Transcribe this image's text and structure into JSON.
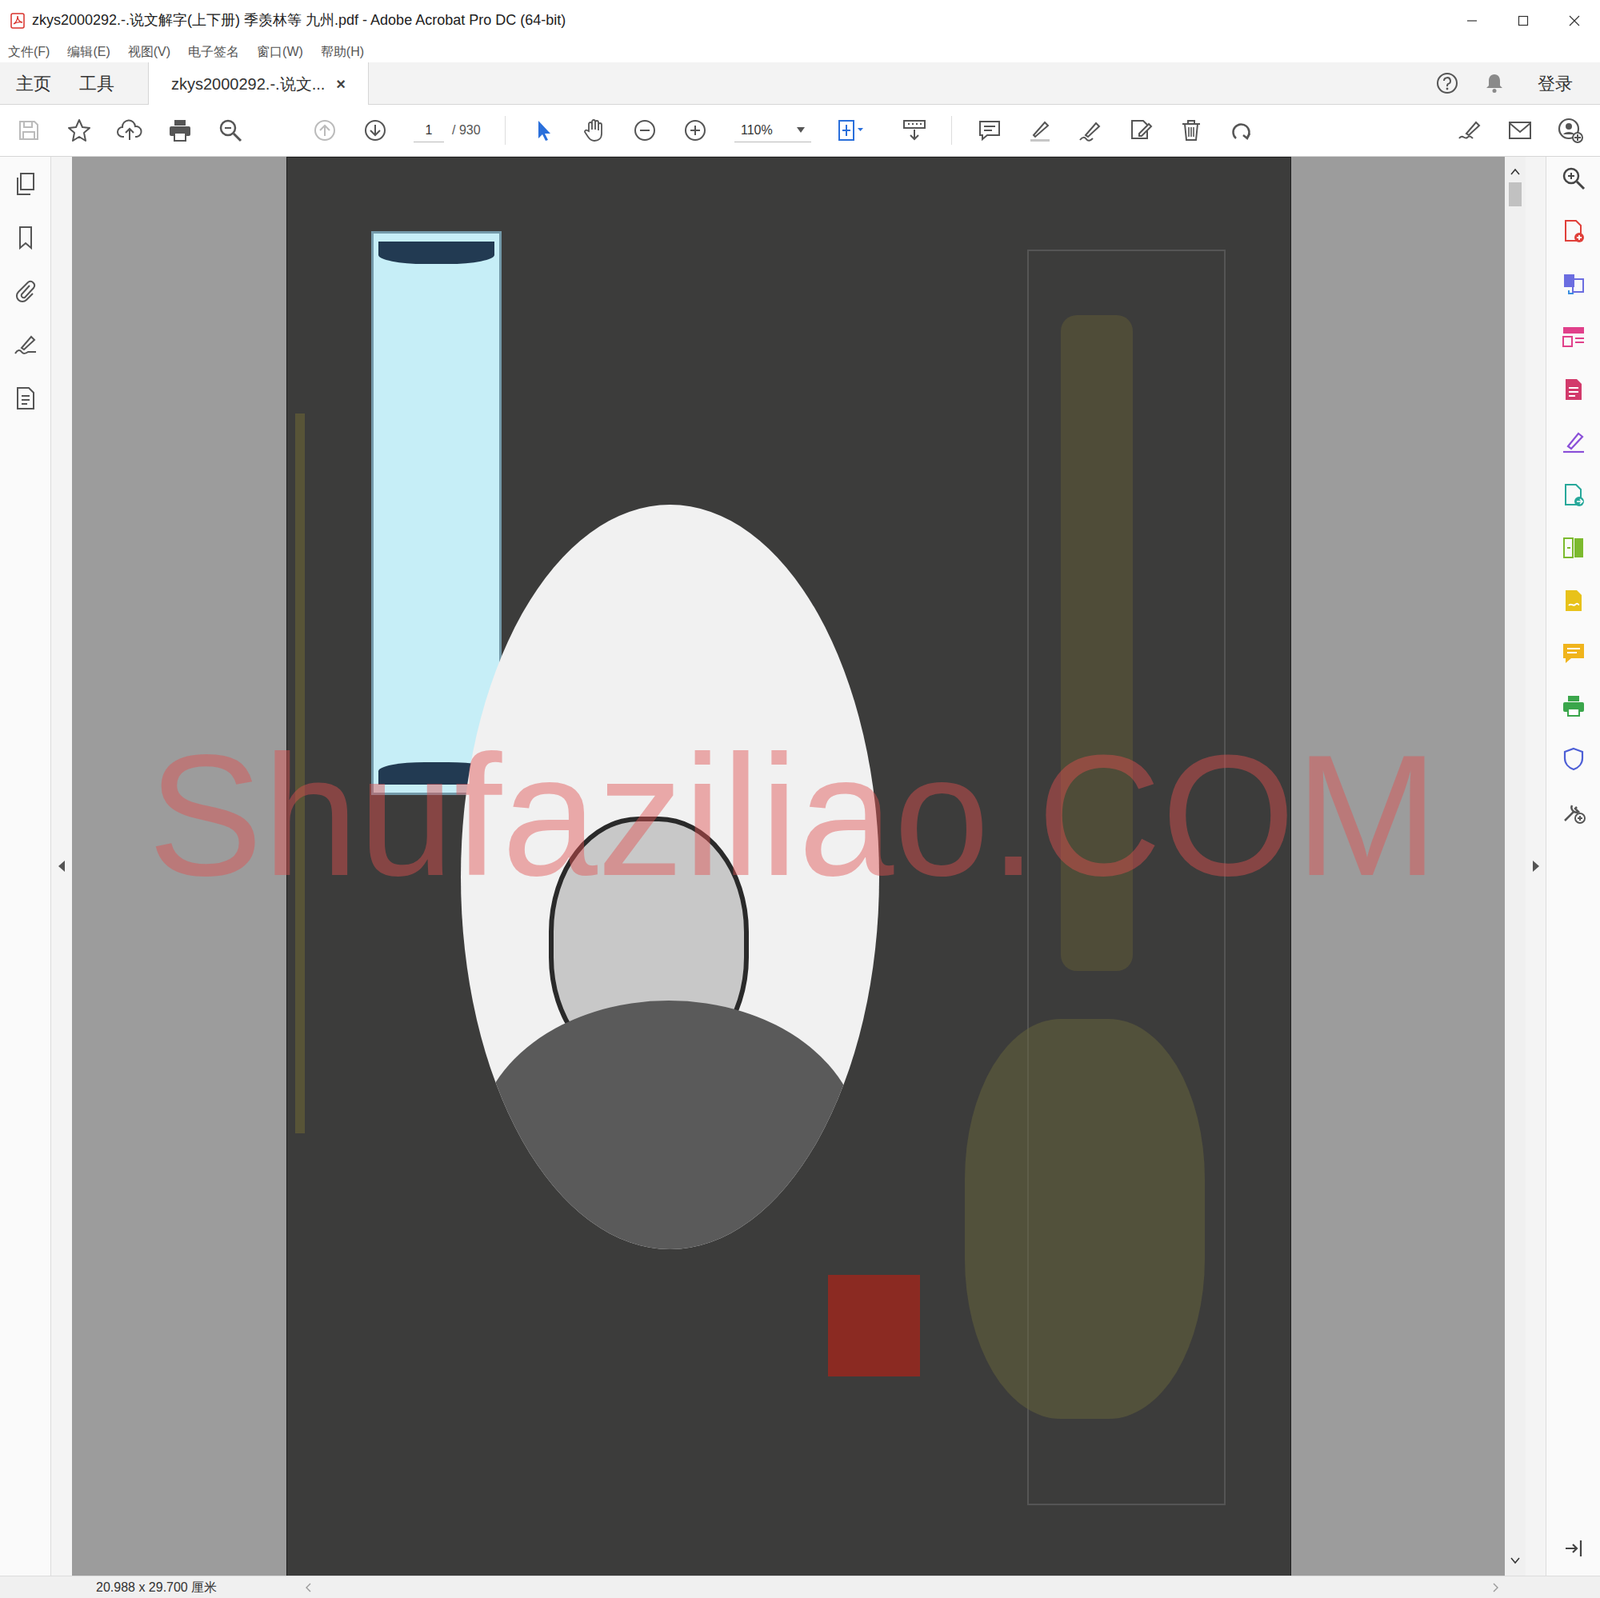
{
  "window": {
    "title": "zkys2000292.-.说文解字(上下册) 季羡林等 九州.pdf - Adobe Acrobat Pro DC (64-bit)"
  },
  "menu": [
    "文件(F)",
    "编辑(E)",
    "视图(V)",
    "电子签名",
    "窗口(W)",
    "帮助(H)"
  ],
  "tabs": [
    {
      "label": "主页",
      "selected": false
    },
    {
      "label": "工具",
      "selected": false
    },
    {
      "label": "zkys2000292.-.说文...",
      "selected": true,
      "close": "×"
    }
  ],
  "account": {
    "sign_in": "登录"
  },
  "toolbar": {
    "page_number": "1",
    "page_count": "/ 930",
    "zoom": "110%",
    "select_tool": {
      "selected": true
    }
  },
  "watermark": "Shufaziliao.COM",
  "status_bar": {
    "page_size": "20.988 x 29.700 厘米"
  }
}
